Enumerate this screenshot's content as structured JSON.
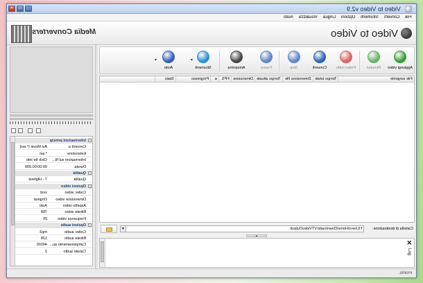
{
  "window": {
    "title": "Video to Video v2.9",
    "controls": [
      "close",
      "maximize",
      "minimize"
    ]
  },
  "menu": {
    "items": [
      "File",
      "Converti",
      "Strumenti",
      "Opzioni",
      "Lingua",
      "Visualizza",
      "Aiuto"
    ]
  },
  "header": {
    "logo_text": "Media Converters",
    "app_title": "Video to Video"
  },
  "toolbar": {
    "buttons": [
      {
        "label": "Aggiungi video",
        "icon": "add-video-icon",
        "color": "#3a9a3a"
      },
      {
        "label": "Rimuovi",
        "icon": "remove-video-icon",
        "color": "#3a9a3a",
        "disabled": true
      },
      {
        "label": "Pulisci tutto",
        "icon": "clear-all-icon",
        "color": "#d33232",
        "disabled": true
      },
      {
        "label": "Converti",
        "icon": "convert-icon",
        "color": "#2e5fb8"
      },
      {
        "label": "Stop",
        "icon": "stop-icon",
        "color": "#2e5fb8",
        "disabled": true
      },
      {
        "label": "Pausa",
        "icon": "pause-icon",
        "color": "#2e5fb8",
        "disabled": true
      },
      {
        "label": "Anteprima",
        "icon": "preview-icon",
        "color": "#444444"
      },
      {
        "label": "Strumenti",
        "icon": "tools-icon",
        "color": "#2a8fd4"
      },
      {
        "label": "Aiuto",
        "icon": "help-icon",
        "color": "#2e5fb8"
      }
    ]
  },
  "filelist": {
    "columns": [
      "File sorgente",
      "Tempo totale",
      "Dimensione file",
      "Tempo attuale",
      "Dimensione",
      "FPS",
      "a",
      "Progresso",
      "Stato"
    ]
  },
  "destination": {
    "label": "Cartella di destinazione:",
    "path": "f:\\Users\\Home\\Downloads\\VTVideoOutput\\"
  },
  "properties": {
    "rows": [
      {
        "type": "section",
        "key": "Informazioni principali"
      },
      {
        "key": "Converti a",
        "value": "Avi Movie (*.avi)"
      },
      {
        "key": "Estensione",
        "value": "*.avi"
      },
      {
        "key": "Informazioni sul fil...",
        "value": "Click for info"
      },
      {
        "key": "Durata",
        "value": "00:00:00.000"
      },
      {
        "type": "section",
        "key": "Qualità"
      },
      {
        "key": "Qualità",
        "value": "7 - Highest"
      },
      {
        "type": "section",
        "key": "Opzioni video"
      },
      {
        "key": "Codec video",
        "value": "xvid"
      },
      {
        "key": "Dimensione video",
        "value": "Original"
      },
      {
        "key": "Aspetto video",
        "value": "Auto"
      },
      {
        "key": "Bitrate video",
        "value": "768"
      },
      {
        "key": "Frequenza video",
        "value": "25"
      },
      {
        "type": "section",
        "key": "Opzioni audio"
      },
      {
        "key": "Codec audio",
        "value": "mp3"
      },
      {
        "key": "Bitrate audio",
        "value": "128"
      },
      {
        "key": "Campionamento au...",
        "value": "44100"
      },
      {
        "key": "Canale audio",
        "value": "2"
      }
    ]
  },
  "log": {
    "title": "Log"
  },
  "status": {
    "text": "Pronto."
  }
}
